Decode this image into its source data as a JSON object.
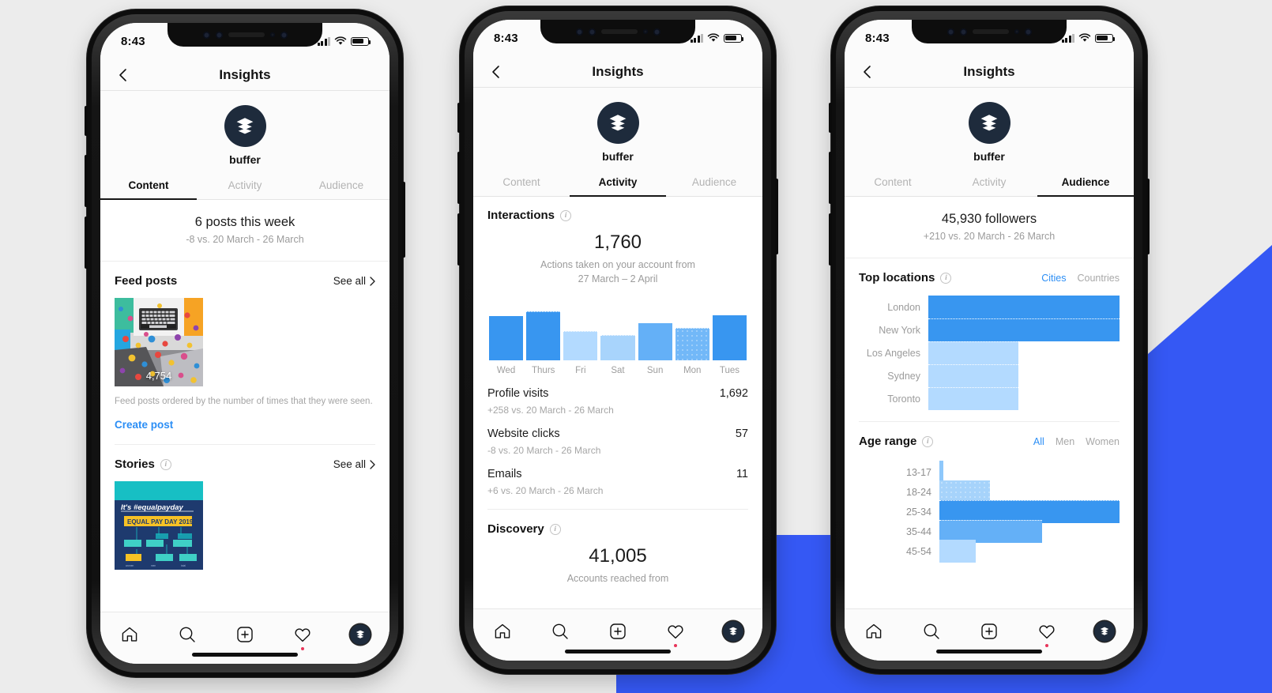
{
  "palette": {
    "page_bg": "#ececec",
    "accent_blue": "#3558f4",
    "bar_dark_blue": "#3896f0",
    "bar_mid_blue": "#64b0f7",
    "bar_light_blue": "#b3daff",
    "link_blue": "#2b8ef5",
    "brand_navy": "#1e2b3c"
  },
  "status_bar": {
    "time": "8:43"
  },
  "nav": {
    "title": "Insights",
    "back_icon": "chevron-left-icon"
  },
  "profile": {
    "handle": "buffer",
    "avatar_icon": "buffer-layers-icon"
  },
  "tabs": [
    {
      "label": "Content"
    },
    {
      "label": "Activity"
    },
    {
      "label": "Audience"
    }
  ],
  "tabbar": {
    "items": [
      {
        "icon": "home-icon"
      },
      {
        "icon": "search-icon"
      },
      {
        "icon": "plus-square-icon"
      },
      {
        "icon": "heart-icon"
      },
      {
        "icon": "profile-avatar-icon"
      }
    ]
  },
  "phone1": {
    "active_tab": "Content",
    "summary": {
      "headline": "6 posts this week",
      "comparison": "-8 vs. 20 March - 26 March"
    },
    "feed_posts": {
      "title": "Feed posts",
      "see_all": "See all",
      "post_count": "4,754",
      "caption": "Feed posts ordered by the number of times that they were seen.",
      "create_post": "Create post"
    },
    "stories": {
      "title": "Stories",
      "see_all": "See all",
      "thumb_headline": "It's #equalpayday",
      "thumb_banner": "EQUAL PAY DAY 2019"
    }
  },
  "phone2": {
    "active_tab": "Activity",
    "interactions": {
      "title": "Interactions",
      "value": "1,760",
      "description_line1": "Actions taken on your account from",
      "description_line2": "27 March – 2 April"
    },
    "stats": [
      {
        "name": "Profile visits",
        "value": "1,692",
        "delta": "+258 vs. 20 March - 26 March"
      },
      {
        "name": "Website clicks",
        "value": "57",
        "delta": "-8 vs. 20 March - 26 March"
      },
      {
        "name": "Emails",
        "value": "11",
        "delta": "+6 vs. 20 March - 26 March"
      }
    ],
    "discovery": {
      "title": "Discovery",
      "value": "41,005",
      "description_clipped": "Accounts reached from"
    }
  },
  "phone3": {
    "active_tab": "Audience",
    "summary": {
      "headline": "45,930 followers",
      "comparison": "+210 vs. 20 March - 26 March"
    },
    "top_locations": {
      "title": "Top locations",
      "toggle": [
        {
          "label": "Cities",
          "selected": true
        },
        {
          "label": "Countries",
          "selected": false
        }
      ]
    },
    "age_range": {
      "title": "Age range",
      "toggle": [
        {
          "label": "All",
          "selected": true
        },
        {
          "label": "Men",
          "selected": false
        },
        {
          "label": "Women",
          "selected": false
        }
      ]
    }
  },
  "chart_data": [
    {
      "type": "bar",
      "id": "interactions-weekly",
      "title": "Interactions",
      "subtitle": "Actions taken on your account from 27 March – 2 April",
      "total": 1760,
      "categories": [
        "Wed",
        "Thurs",
        "Fri",
        "Sat",
        "Sun",
        "Mon",
        "Tues"
      ],
      "values": [
        78,
        86,
        52,
        45,
        65,
        58,
        80
      ],
      "ylim": [
        0,
        100
      ],
      "grid": false,
      "legend": "none",
      "xlabel": "",
      "ylabel": "",
      "bar_colors": [
        "#3896f0",
        "#3896f0",
        "#b3daff",
        "#a8d4fc",
        "#64b0f7",
        "#72b8f8",
        "#3896f0"
      ]
    },
    {
      "type": "bar",
      "id": "top-locations",
      "orientation": "horizontal",
      "title": "Top locations",
      "categories": [
        "London",
        "New York",
        "Los Angeles",
        "Sydney",
        "Toronto"
      ],
      "values": [
        100,
        100,
        47,
        47,
        47
      ],
      "ylim": [
        0,
        100
      ],
      "grid": false,
      "legend": "none",
      "bar_colors": [
        "#3896f0",
        "#3896f0",
        "#b3daff",
        "#b3daff",
        "#b3daff"
      ]
    },
    {
      "type": "bar",
      "id": "age-range",
      "orientation": "horizontal",
      "title": "Age range",
      "categories": [
        "13-17",
        "18-24",
        "25-34",
        "35-44",
        "45-54"
      ],
      "values": [
        2,
        28,
        100,
        57,
        20
      ],
      "ylim": [
        0,
        100
      ],
      "grid": false,
      "legend": "none",
      "bar_colors": [
        "#8ec8fb",
        "#a6d3fb",
        "#3896f0",
        "#64b0f7",
        "#b3daff"
      ]
    }
  ]
}
